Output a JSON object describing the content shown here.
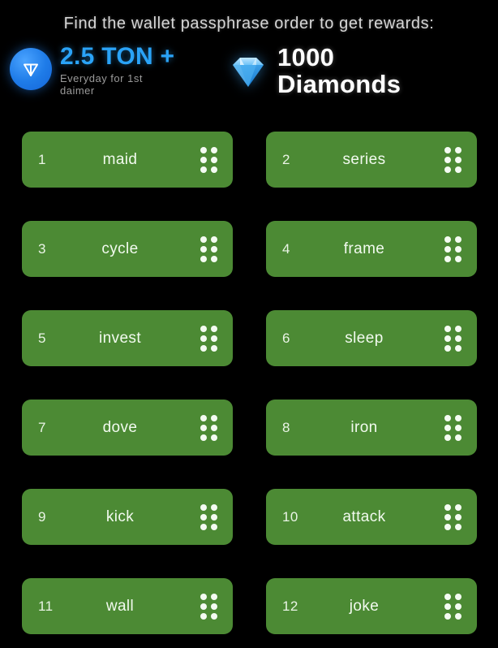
{
  "header": {
    "title": "Find the wallet passphrase order to get rewards:"
  },
  "rewards": [
    {
      "icon": "ton-logo-icon",
      "amount": "2.5 TON +",
      "subtitle": "Everyday for 1st daimer",
      "color": "#2aa3f7"
    },
    {
      "icon": "diamond-gem-icon",
      "amount": "1000",
      "label": "Diamonds",
      "color": "#ffffff"
    }
  ],
  "colors": {
    "background": "#000000",
    "tile_green": "#4c8a34",
    "ton_blue": "#2aa3f7",
    "header_text": "#d6d6d6",
    "subtitle_text": "#9a9a9a"
  },
  "passphrase_tiles": [
    {
      "index": "1",
      "word": "maid"
    },
    {
      "index": "2",
      "word": "series"
    },
    {
      "index": "3",
      "word": "cycle"
    },
    {
      "index": "4",
      "word": "frame"
    },
    {
      "index": "5",
      "word": "invest"
    },
    {
      "index": "6",
      "word": "sleep"
    },
    {
      "index": "7",
      "word": "dove"
    },
    {
      "index": "8",
      "word": "iron"
    },
    {
      "index": "9",
      "word": "kick"
    },
    {
      "index": "10",
      "word": "attack"
    },
    {
      "index": "11",
      "word": "wall"
    },
    {
      "index": "12",
      "word": "joke"
    }
  ],
  "drag_handle": {
    "icon": "drag-handle-dots-icon",
    "dot_count": 6
  }
}
